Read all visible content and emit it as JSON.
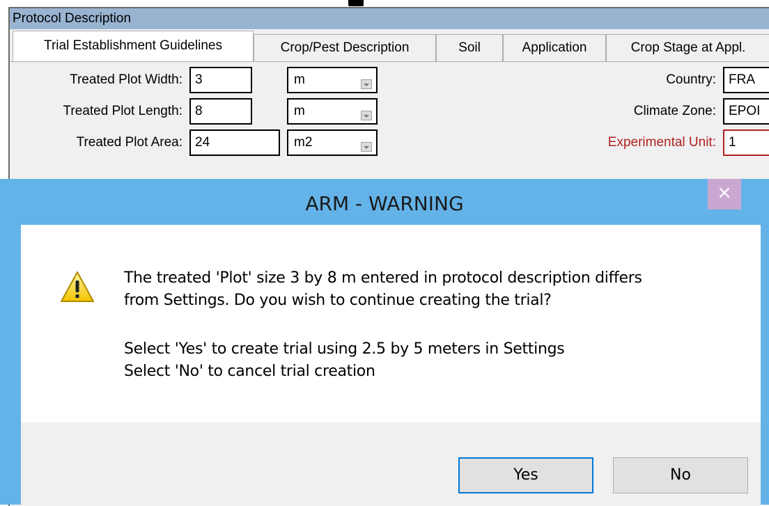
{
  "window": {
    "title": "Protocol Description"
  },
  "tabs": [
    {
      "label": "Trial Establishment Guidelines"
    },
    {
      "label": "Crop/Pest Description"
    },
    {
      "label": "Soil"
    },
    {
      "label": "Application"
    },
    {
      "label": "Crop Stage at Appl."
    }
  ],
  "form": {
    "width": {
      "label": "Treated Plot Width:",
      "value": "3",
      "unit": "m"
    },
    "length": {
      "label": "Treated Plot Length:",
      "value": "8",
      "unit": "m"
    },
    "area": {
      "label": "Treated Plot Area:",
      "value": "24",
      "unit": "m2"
    },
    "country": {
      "label": "Country:",
      "value": "FRA"
    },
    "climate_zone": {
      "label": "Climate Zone:",
      "value": "EPOI"
    },
    "exp_unit": {
      "label": "Experimental Unit:",
      "value": "1"
    }
  },
  "dialog": {
    "title": "ARM - WARNING",
    "close_glyph": "×",
    "icon": "warning-icon",
    "line1": "The treated 'Plot' size 3 by 8 m entered in protocol description differs",
    "line2": "from Settings. Do you wish to continue creating the trial?",
    "line3": "Select 'Yes' to create trial using 2.5 by 5 meters in Settings",
    "line4": "Select 'No' to cancel trial creation",
    "yes_label": "Yes",
    "no_label": "No"
  },
  "colors": {
    "dialog_border": "#63b3e8",
    "title_bar": "#99b4d1",
    "label_red": "#b02020",
    "default_button_border": "#0078d7"
  }
}
